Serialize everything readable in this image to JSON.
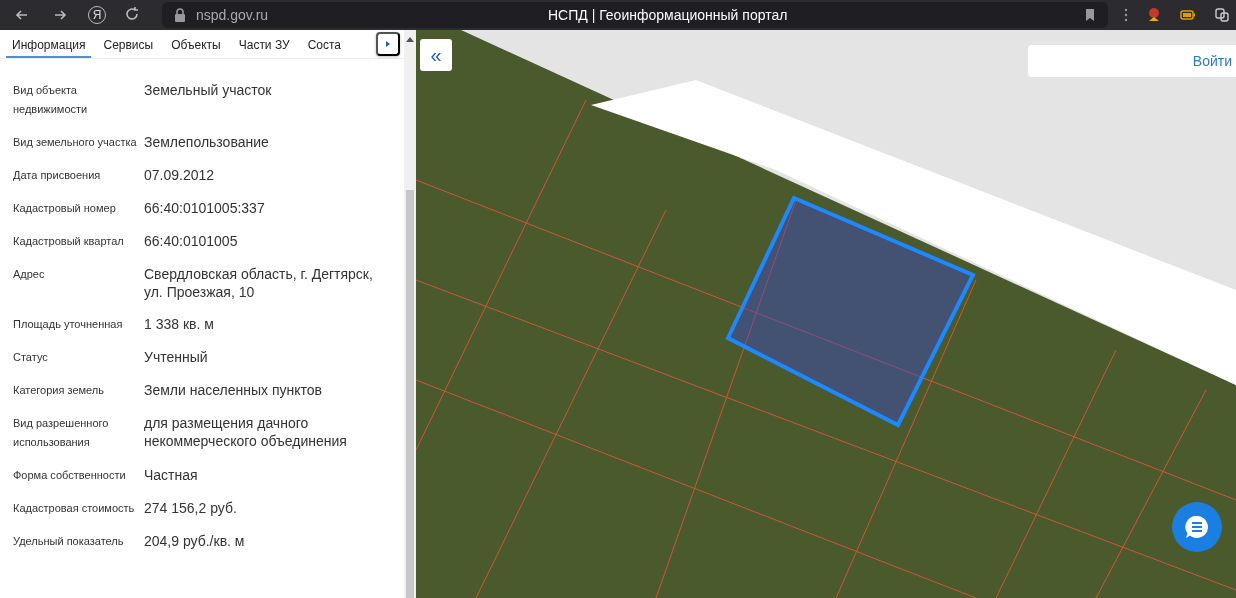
{
  "browser": {
    "logo": "Я",
    "url": "nspd.gov.ru",
    "title": "НСПД | Геоинформационный портал"
  },
  "tabs": [
    {
      "label": "Информация",
      "selected": true
    },
    {
      "label": "Сервисы",
      "selected": false
    },
    {
      "label": "Объекты",
      "selected": false
    },
    {
      "label": "Части ЗУ",
      "selected": false
    },
    {
      "label": "Соста",
      "selected": false
    }
  ],
  "properties": [
    {
      "label": "Вид объекта недвижимости",
      "value": "Земельный участок"
    },
    {
      "label": "Вид земельного участка",
      "value": "Землепользование"
    },
    {
      "label": "Дата присвоения",
      "value": "07.09.2012"
    },
    {
      "label": "Кадастровый номер",
      "value": "66:40:0101005:337"
    },
    {
      "label": "Кадастровый квартал",
      "value": "66:40:0101005"
    },
    {
      "label": "Адрес",
      "value": "Свердловская область, г. Дегтярск, ул. Проезжая, 10"
    },
    {
      "label": "Площадь уточненная",
      "value": "1 338 кв. м"
    },
    {
      "label": "Статус",
      "value": "Учтенный"
    },
    {
      "label": "Категория земель",
      "value": "Земли населенных пунктов"
    },
    {
      "label": "Вид разрешенного использования",
      "value": "для размещения дачного некоммерческого объединения"
    },
    {
      "label": "Форма собственности",
      "value": "Частная"
    },
    {
      "label": "Кадастровая стоимость",
      "value": "274 156,2 руб."
    },
    {
      "label": "Удельный показатель",
      "value": "204,9 руб./кв. м"
    }
  ],
  "map": {
    "collapse_button": "«",
    "login_button": "Войти"
  }
}
